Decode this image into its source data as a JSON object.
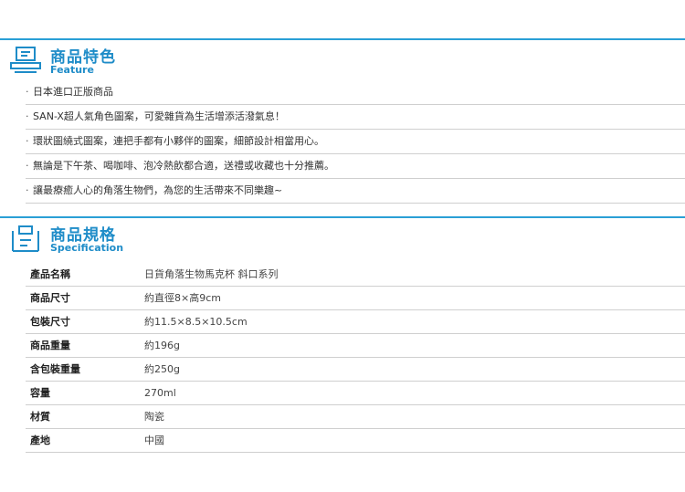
{
  "feature": {
    "title": "商品特色",
    "subtitle": "Feature",
    "icon": "monitor-icon",
    "items": [
      "日本進口正版商品",
      "SAN-X超人氣角色圖案，可愛雜貨為生活增添活潑氣息！",
      "環狀圖繞式圖案，連把手都有小夥伴的圖案，細節設計相當用心。",
      "無論是下午茶、喝咖啡、泡冷熱飲都合適，送禮或收藏也十分推薦。",
      "讓最療癒人心的角落生物們，為您的生活帶來不同樂趣~"
    ]
  },
  "spec": {
    "title": "商品規格",
    "subtitle": "Specification",
    "icon": "spec-icon",
    "rows": [
      {
        "key": "產品名稱",
        "value": "日貨角落生物馬克杯 斜口系列"
      },
      {
        "key": "商品尺寸",
        "value": "約直徑8×高9cm"
      },
      {
        "key": "包裝尺寸",
        "value": "約11.5×8.5×10.5cm"
      },
      {
        "key": "商品重量",
        "value": "約196g"
      },
      {
        "key": "含包裝重量",
        "value": "約250g"
      },
      {
        "key": "容量",
        "value": "270ml"
      },
      {
        "key": "材質",
        "value": "陶瓷"
      },
      {
        "key": "產地",
        "value": "中國"
      }
    ]
  },
  "colors": {
    "accent": "#2a9fd6",
    "heading": "#1e8cc8"
  }
}
